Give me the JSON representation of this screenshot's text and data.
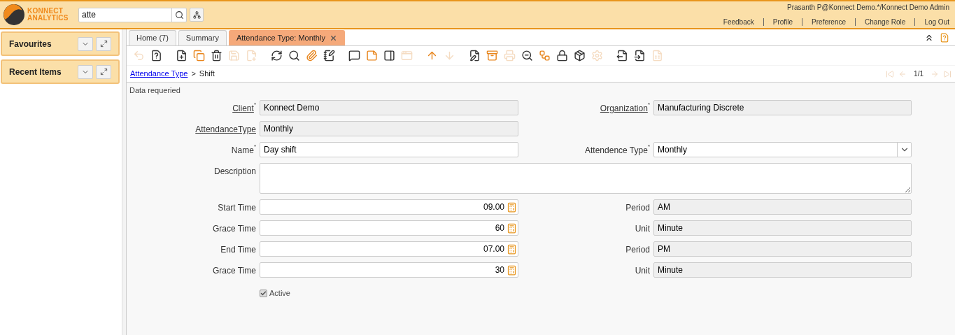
{
  "header": {
    "logo_line1": "KONNECT",
    "logo_line2": "ANALYTICS",
    "search": {
      "value": "atte"
    },
    "user": "Prasanth P@Konnect Demo.*/Konnect Demo Admin",
    "links": [
      "Feedback",
      "Profile",
      "Preference",
      "Change Role",
      "Log Out"
    ]
  },
  "sidebar": {
    "panels": [
      {
        "title": "Favourites"
      },
      {
        "title": "Recent Items"
      }
    ]
  },
  "tabs": [
    {
      "label": "Home (7)",
      "selected": false,
      "closable": false
    },
    {
      "label": "Summary",
      "selected": false,
      "closable": false
    },
    {
      "label": "Attendance Type: Monthly",
      "selected": true,
      "closable": true
    }
  ],
  "toolbar": [
    {
      "disabled": true
    },
    {
      "disabled": false
    },
    {
      "disabled": false
    },
    {
      "disabled": false
    },
    {
      "disabled": false
    },
    {
      "disabled": true
    },
    {
      "disabled": true
    },
    {
      "disabled": false
    },
    {
      "disabled": false
    },
    {
      "disabled": false
    },
    {
      "disabled": false
    },
    {
      "disabled": false
    },
    {
      "disabled": false
    },
    {
      "disabled": false
    },
    {
      "disabled": true
    },
    {
      "disabled": false
    },
    {
      "disabled": true
    },
    {
      "disabled": false
    },
    {
      "disabled": false
    },
    {
      "disabled": true
    },
    {
      "disabled": false
    },
    {
      "disabled": false
    },
    {
      "disabled": false
    },
    {
      "disabled": false
    },
    {
      "disabled": true
    },
    {
      "disabled": false
    },
    {
      "disabled": false
    },
    {
      "disabled": true
    }
  ],
  "breadcrumb": {
    "parent": "Attendance Type",
    "separator": ">",
    "current": "Shift"
  },
  "record_counter": "1/1",
  "status_message": "Data requeried",
  "form": {
    "rows": [
      [
        {
          "label": "Client",
          "value": "Konnect Demo",
          "kind": "text",
          "readonly": true,
          "required_mark": "*",
          "link": true
        },
        {
          "label": "Organization",
          "value": "Manufacturing Discrete",
          "kind": "text",
          "readonly": true,
          "required_mark": "*",
          "link": true
        }
      ],
      [
        {
          "label": "AttendanceType",
          "value": "Monthly",
          "kind": "text",
          "readonly": true,
          "link": true
        }
      ],
      [
        {
          "label": "Name",
          "value": "Day shift",
          "kind": "text",
          "readonly": false,
          "required_mark": "*",
          "link": false
        },
        {
          "label": "Attendence Type",
          "value": "Monthly",
          "kind": "select",
          "readonly": false,
          "required_mark": "*",
          "link": false
        }
      ],
      [
        {
          "label": "Description",
          "kind": "textarea",
          "readonly": false,
          "link": false
        }
      ],
      [
        {
          "label": "Start Time",
          "value": "09.00",
          "kind": "number",
          "readonly": false,
          "link": false
        },
        {
          "label": "Period",
          "value": "AM",
          "kind": "text",
          "readonly": true,
          "link": false
        }
      ],
      [
        {
          "label": "Grace Time",
          "value": "60",
          "kind": "number",
          "readonly": false,
          "link": false
        },
        {
          "label": "Unit",
          "value": "Minute",
          "kind": "text",
          "readonly": true,
          "link": false
        }
      ],
      [
        {
          "label": "End Time",
          "value": "07.00",
          "kind": "number",
          "readonly": false,
          "link": false
        },
        {
          "label": "Period",
          "value": "PM",
          "kind": "text",
          "readonly": true,
          "link": false
        }
      ],
      [
        {
          "label": "Grace Time",
          "value": "30",
          "kind": "number",
          "readonly": false,
          "link": false
        },
        {
          "label": "Unit",
          "value": "Minute",
          "kind": "text",
          "readonly": true,
          "link": false
        }
      ]
    ],
    "checkbox": {
      "label": "Active",
      "checked": true
    }
  }
}
